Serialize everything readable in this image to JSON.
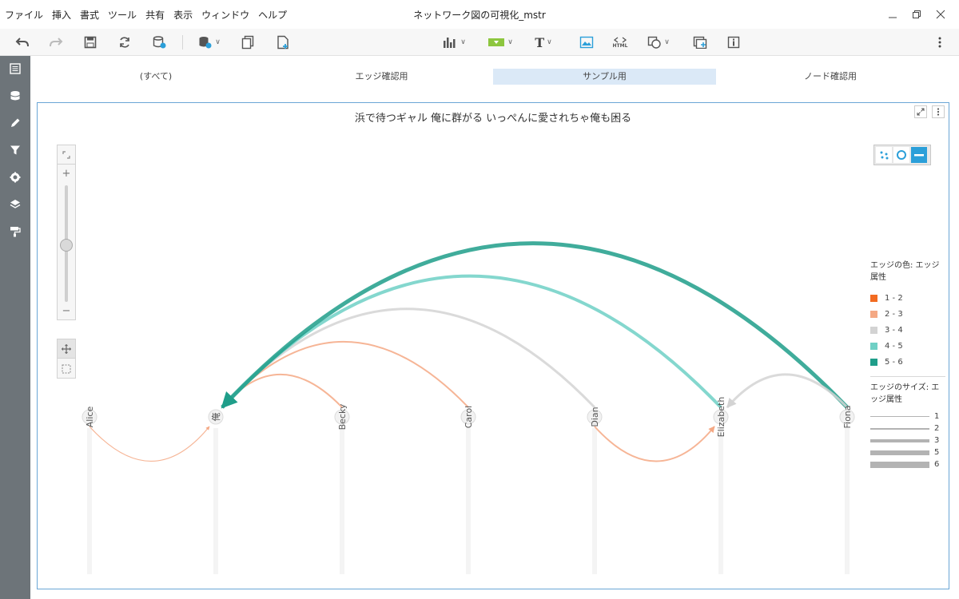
{
  "menu": [
    "ファイル",
    "挿入",
    "書式",
    "ツール",
    "共有",
    "表示",
    "ウィンドウ",
    "ヘルプ"
  ],
  "app_title": "ネットワーク図の可視化_mstr",
  "toolbar": {
    "icons": [
      "undo-icon",
      "redo-icon",
      "save-icon",
      "refresh-icon",
      "data-view-icon",
      "add-data-icon",
      "duplicate-page-icon",
      "new-page-icon",
      "chart-icon",
      "filter-icon",
      "text-icon",
      "image-icon",
      "html-icon",
      "shape-icon",
      "container-icon",
      "info-icon",
      "more-icon"
    ],
    "text_label": "T",
    "html_label": "HTML"
  },
  "tabs": [
    {
      "label": "(すべて)",
      "active": false
    },
    {
      "label": "エッジ確認用",
      "active": false
    },
    {
      "label": "サンプル用",
      "active": true
    },
    {
      "label": "ノード確認用",
      "active": false
    }
  ],
  "viz": {
    "title": "浜で待つギャル 俺に群がる いっぺんに愛されちゃ俺も困る",
    "nodes": [
      "Alice",
      "俺",
      "Becky",
      "Carol",
      "Dian",
      "Elizabeth",
      "Fiona"
    ],
    "edges": [
      {
        "from": "Alice",
        "to": "俺",
        "attr": 2.5,
        "size": 1
      },
      {
        "from": "Becky",
        "to": "俺",
        "attr": 2.0,
        "size": 2
      },
      {
        "from": "Carol",
        "to": "俺",
        "attr": 2.6,
        "size": 2
      },
      {
        "from": "Dian",
        "to": "俺",
        "attr": 3.5,
        "size": 3
      },
      {
        "from": "Elizabeth",
        "to": "俺",
        "attr": 4.5,
        "size": 5
      },
      {
        "from": "Fiona",
        "to": "俺",
        "attr": 5.5,
        "size": 6
      },
      {
        "from": "Dian",
        "to": "Elizabeth",
        "attr": 2.2,
        "size": 2
      },
      {
        "from": "Fiona",
        "to": "Elizabeth",
        "attr": 3.5,
        "size": 3
      }
    ]
  },
  "legend": {
    "color_title": "エッジの色: エッジ属性",
    "color_items": [
      {
        "label": "1 - 2",
        "color": "#f26b21"
      },
      {
        "label": "2 - 3",
        "color": "#f4a884"
      },
      {
        "label": "3 - 4",
        "color": "#d3d3d3"
      },
      {
        "label": "4 - 5",
        "color": "#6fd0c5"
      },
      {
        "label": "5 - 6",
        "color": "#1f9e8a"
      }
    ],
    "size_title": "エッジのサイズ: エッジ属性",
    "size_items": [
      {
        "label": "1",
        "width": 1
      },
      {
        "label": "2",
        "width": 2
      },
      {
        "label": "3",
        "width": 4
      },
      {
        "label": "5",
        "width": 6
      },
      {
        "label": "6",
        "width": 8
      }
    ]
  },
  "zoom": {
    "level": 0.15
  }
}
